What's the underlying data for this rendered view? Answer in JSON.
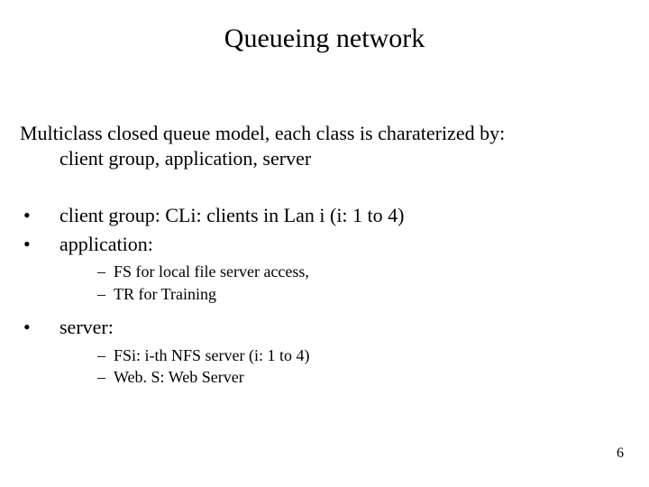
{
  "title": "Queueing network",
  "intro": {
    "line1": "Multiclass closed queue model, each class is charaterized by:",
    "line2": "client group, application, server"
  },
  "items": [
    {
      "text": "client group: CLi: clients in Lan i (i: 1 to 4)",
      "sub": []
    },
    {
      "text": "application:",
      "sub": [
        "FS for local file server access,",
        "TR for Training"
      ]
    },
    {
      "text": "server:",
      "sub": [
        "FSi: i-th NFS server (i: 1 to 4)",
        "Web. S: Web Server"
      ]
    }
  ],
  "page_number": "6",
  "glyphs": {
    "bullet": "•",
    "dash": "–"
  }
}
